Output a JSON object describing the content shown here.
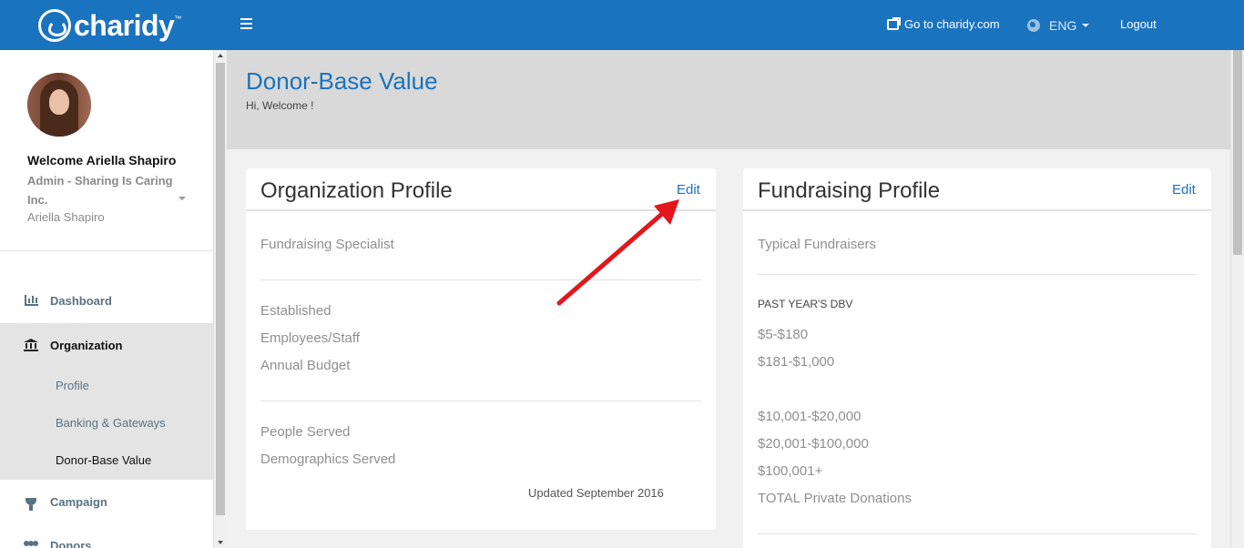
{
  "topbar": {
    "logo_text": "charidy",
    "logo_tm": "™",
    "go_link": "Go to charidy.com",
    "language": "ENG",
    "logout": "Logout"
  },
  "sidebar": {
    "welcome": "Welcome Ariella Shapiro",
    "role": "Admin - Sharing Is Caring Inc.",
    "name": "Ariella Shapiro",
    "nav": {
      "dashboard": "Dashboard",
      "organization": "Organization",
      "profile": "Profile",
      "banking": "Banking & Gateways",
      "donor_base": "Donor-Base Value",
      "campaign": "Campaign",
      "donors": "Donors"
    }
  },
  "main": {
    "title": "Donor-Base Value",
    "subtitle": "Hi, Welcome !",
    "org_profile": {
      "title": "Organization Profile",
      "edit": "Edit",
      "specialist": "Fundraising Specialist",
      "established": "Established",
      "employees": "Employees/Staff",
      "budget": "Annual Budget",
      "people_served": "People Served",
      "demographics": "Demographics Served",
      "updated": "Updated September 2016"
    },
    "fund_profile": {
      "title": "Fundraising Profile",
      "edit": "Edit",
      "typical": "Typical Fundraisers",
      "past_dbv": "PAST YEAR'S DBV",
      "ranges": [
        "$5-$180",
        "$181-$1,000",
        "$10,001-$20,000",
        "$20,001-$100,000",
        "$100,001+"
      ],
      "total": "TOTAL Private Donations"
    }
  },
  "colors": {
    "brand_blue": "#1a73be",
    "annotation_arrow": "#e3161b"
  }
}
